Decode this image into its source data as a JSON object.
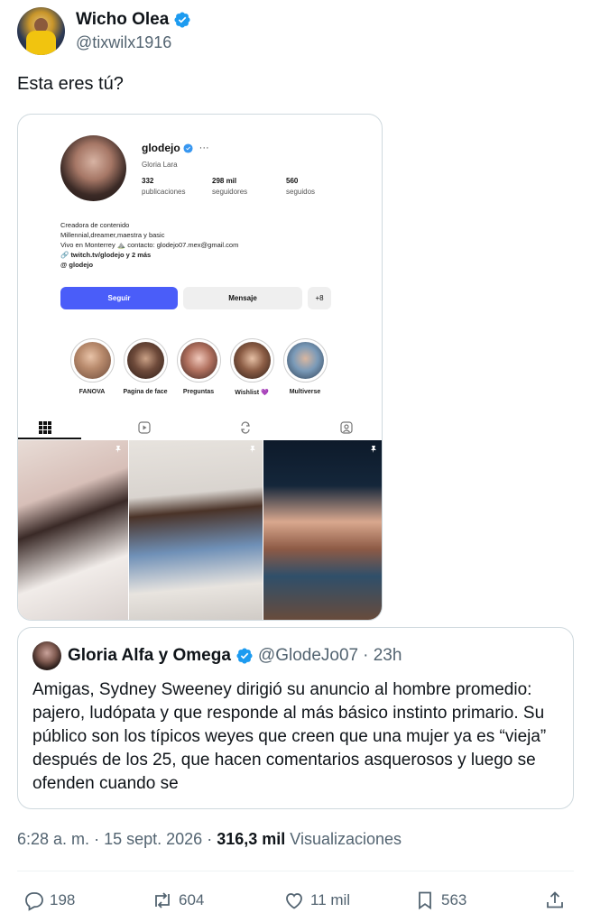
{
  "author": {
    "display_name": "Wicho Olea",
    "handle": "@tixwilx1916",
    "verified": true
  },
  "tweet": {
    "text": "Esta eres tú?"
  },
  "embedded_profile": {
    "username": "glodejo",
    "more": "···",
    "full_name": "Gloria Lara",
    "stats": [
      {
        "num": "332",
        "label": "publicaciones"
      },
      {
        "num": "298 mil",
        "label": "seguidores"
      },
      {
        "num": "560",
        "label": "seguidos"
      }
    ],
    "bio_lines": [
      "Creadora de contenido",
      "Millennial,dreamer,maestra y basic",
      "Vivo en Monterrey ⛰️ contacto: glodejo07.mex@gmail.com"
    ],
    "link": "twitch.tv/glodejo y 2 más",
    "threads": "glodejo",
    "follow_label": "Seguir",
    "message_label": "Mensaje",
    "add_label": "+8",
    "highlights": [
      "FANOVA",
      "Pagina de face",
      "Preguntas",
      "Wishlist 💜",
      "Multiverse"
    ]
  },
  "quote": {
    "display_name": "Gloria Alfa y Omega",
    "handle": "@GlodeJo07",
    "time": "· 23h",
    "text": "Amigas, Sydney Sweeney dirigió su anuncio al hombre promedio: pajero, ludópata y que responde al más básico instinto primario. Su público son los típicos weyes que creen que una mujer ya es “vieja” después de los 25, que hacen comentarios asquerosos y luego se ofenden cuando se"
  },
  "meta": {
    "time": "6:28 a. m.",
    "sep": "·",
    "date": "15 sept. 2026",
    "sep2": "·",
    "views": "316,3 mil",
    "views_label": "Visualizaciones"
  },
  "actions": {
    "replies": "198",
    "reposts": "604",
    "likes": "11 mil",
    "bookmarks": "563"
  },
  "colors": {
    "verified_blue": "#1d9bf0",
    "follow_button": "#4a5df9",
    "secondary_text": "#536471"
  }
}
